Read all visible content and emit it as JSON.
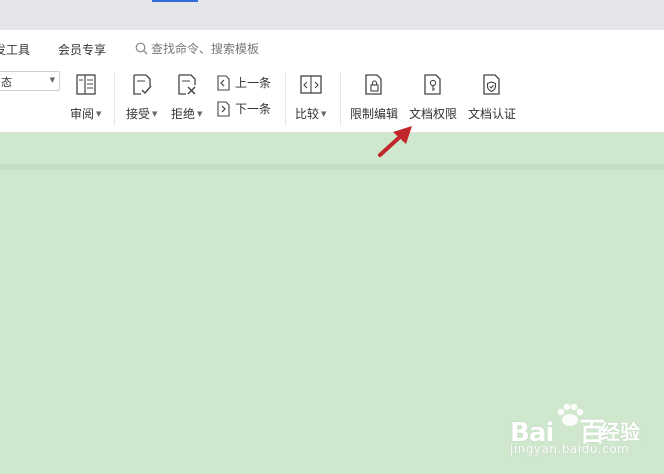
{
  "menubar": {
    "items": [
      "发工具",
      "会员专享"
    ],
    "search_placeholder": "查找命令、搜索模板"
  },
  "ribbon": {
    "status_select_value": "态",
    "review_label": "审阅",
    "accept_label": "接受",
    "reject_label": "拒绝",
    "prev_label": "上一条",
    "next_label": "下一条",
    "compare_label": "比较",
    "restrict_edit_label": "限制编辑",
    "doc_permission_label": "文档权限",
    "doc_cert_label": "文档认证"
  },
  "watermark": {
    "logo": "Bai",
    "logo_end": "百",
    "text": "经验",
    "url": "jingyan.baidu.com"
  },
  "colors": {
    "canvas": "#cfe7cd",
    "accent": "#2f6bd8",
    "arrow": "#c0262a"
  }
}
